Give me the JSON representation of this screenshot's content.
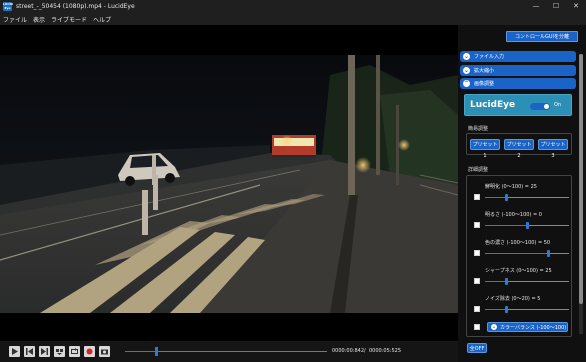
{
  "window": {
    "app_icon_text": "LUCID Eye",
    "title": "street_-_50454 (1080p).mp4 - LucidEye",
    "minimize": "—",
    "maximize": "☐",
    "close": "✕"
  },
  "menu": [
    "ファイル",
    "表示",
    "ライブモード",
    "ヘルプ"
  ],
  "panel": {
    "split_button": "コントロールGUIを分離",
    "accordions": [
      "ファイル入力",
      "拡大縮小",
      "画像調整"
    ],
    "lucid": {
      "title": "LucidEye",
      "toggle_label": "On",
      "toggle_on": true
    },
    "simple_adjust_label": "簡易調整",
    "presets": [
      "プリセット1",
      "プリセット2",
      "プリセット3"
    ],
    "detail_adjust_label": "詳細調整",
    "sliders": [
      {
        "label": "鮮明化 (0〜100) = 25",
        "min": 0,
        "max": 100,
        "value": 25
      },
      {
        "label": "明るさ (-100〜100) = 0",
        "min": -100,
        "max": 100,
        "value": 0
      },
      {
        "label": "色の濃さ (-100〜100) = 50",
        "min": -100,
        "max": 100,
        "value": 50
      },
      {
        "label": "シャープネス (0〜100) = 25",
        "min": 0,
        "max": 100,
        "value": 25
      },
      {
        "label": "ノイズ除去 (0〜20) = 5",
        "min": 0,
        "max": 20,
        "value": 5
      }
    ],
    "color_balance_label": "カラーバランス (-100〜100)",
    "all_off_label": "全OFF"
  },
  "playback": {
    "current_time": "0000:00:842",
    "separator": "/",
    "total_time": "0000:05:525",
    "progress": 0.152
  },
  "colors": {
    "accent": "#1a64c8",
    "lucid_box": "#2c8fb5",
    "panel_bg": "#101010",
    "titlebar_bg": "#1f1f1f"
  }
}
